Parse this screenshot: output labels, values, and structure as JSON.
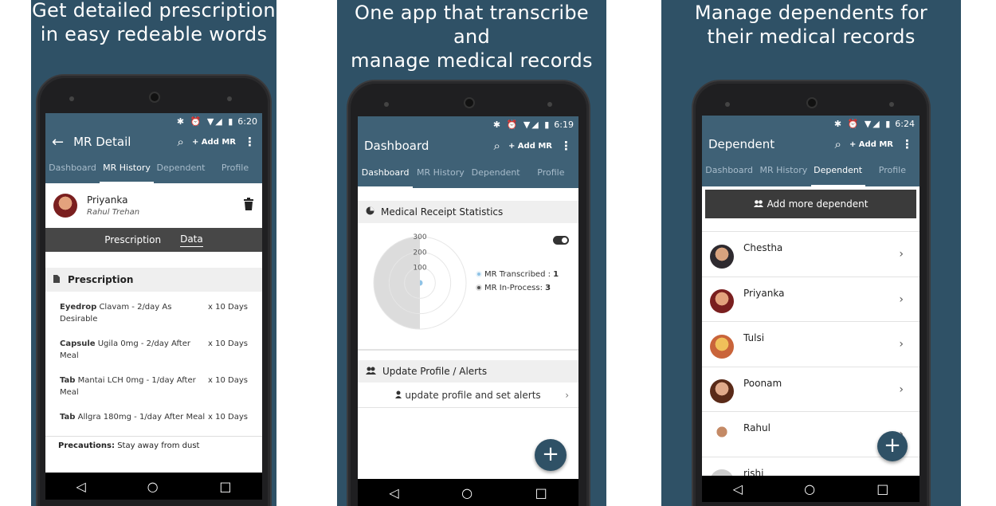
{
  "panels": [
    {
      "caption_line1": "Get detailed prescription",
      "caption_line2": "in easy redeable words"
    },
    {
      "caption_line1": "One app that transcribe and",
      "caption_line2": "manage medical records"
    },
    {
      "caption_line1": "Manage dependents for",
      "caption_line2": "their medical records"
    }
  ],
  "status_icons": "✱ ⏰ ▼◢ ▮",
  "times": [
    "6:20",
    "6:19",
    "6:24"
  ],
  "appbar": {
    "add_mr": "+ Add MR",
    "search_icon": "⌕",
    "more_icon": "⋮",
    "back_icon": "←"
  },
  "tabs": [
    "Dashboard",
    "MR History",
    "Dependent",
    "Profile"
  ],
  "screen1": {
    "title": "MR Detail",
    "patient_name": "Priyanka",
    "doctor_name": "Rahul Trehan",
    "subtab_prescription": "Prescription",
    "subtab_data": "Data",
    "section_title": "Prescription",
    "prescriptions": [
      {
        "type": "Eyedrop",
        "detail": "Clavam   - 2/day As Desirable",
        "duration": "x 10 Days"
      },
      {
        "type": "Capsule",
        "detail": "Ugila  0mg - 2/day After Meal",
        "duration": "x 10 Days"
      },
      {
        "type": "Tab",
        "detail": "Mantai LCH  0mg - 1/day After Meal",
        "duration": "x 10 Days"
      },
      {
        "type": "Tab",
        "detail": "Allgra  180mg - 1/day After Meal",
        "duration": "x 10 Days"
      }
    ],
    "precautions_label": "Precautions:",
    "precautions_text": "Stay away from dust"
  },
  "screen2": {
    "title": "Dashboard",
    "stats_title": "Medical Receipt Statistics",
    "ticks": [
      "300",
      "200",
      "100"
    ],
    "legend": [
      {
        "label": "MR Transcribed :",
        "value": "1",
        "color": "#8fc3e6"
      },
      {
        "label": "MR In-Process:",
        "value": "3",
        "color": "#9e9e9e"
      }
    ],
    "chart_data": {
      "type": "pie",
      "categories": [
        "MR Transcribed",
        "MR In-Process"
      ],
      "values": [
        1,
        3
      ],
      "rings": [
        100,
        200,
        300
      ]
    },
    "update_title": "Update Profile / Alerts",
    "update_link": "update profile and set alerts",
    "fab": "+"
  },
  "screen3": {
    "title": "Dependent",
    "add_button": "Add more dependent",
    "dependents": [
      "Chestha",
      "Priyanka",
      "Tulsi",
      "Poonam",
      "Rahul",
      "rishi"
    ],
    "fab": "+"
  },
  "nav": {
    "back": "◁",
    "home": "○",
    "recent": "□"
  },
  "colors": {
    "panel_bg": "#2f5166",
    "appbar": "#3f6176",
    "accent_chart": "#8fc3e6"
  }
}
